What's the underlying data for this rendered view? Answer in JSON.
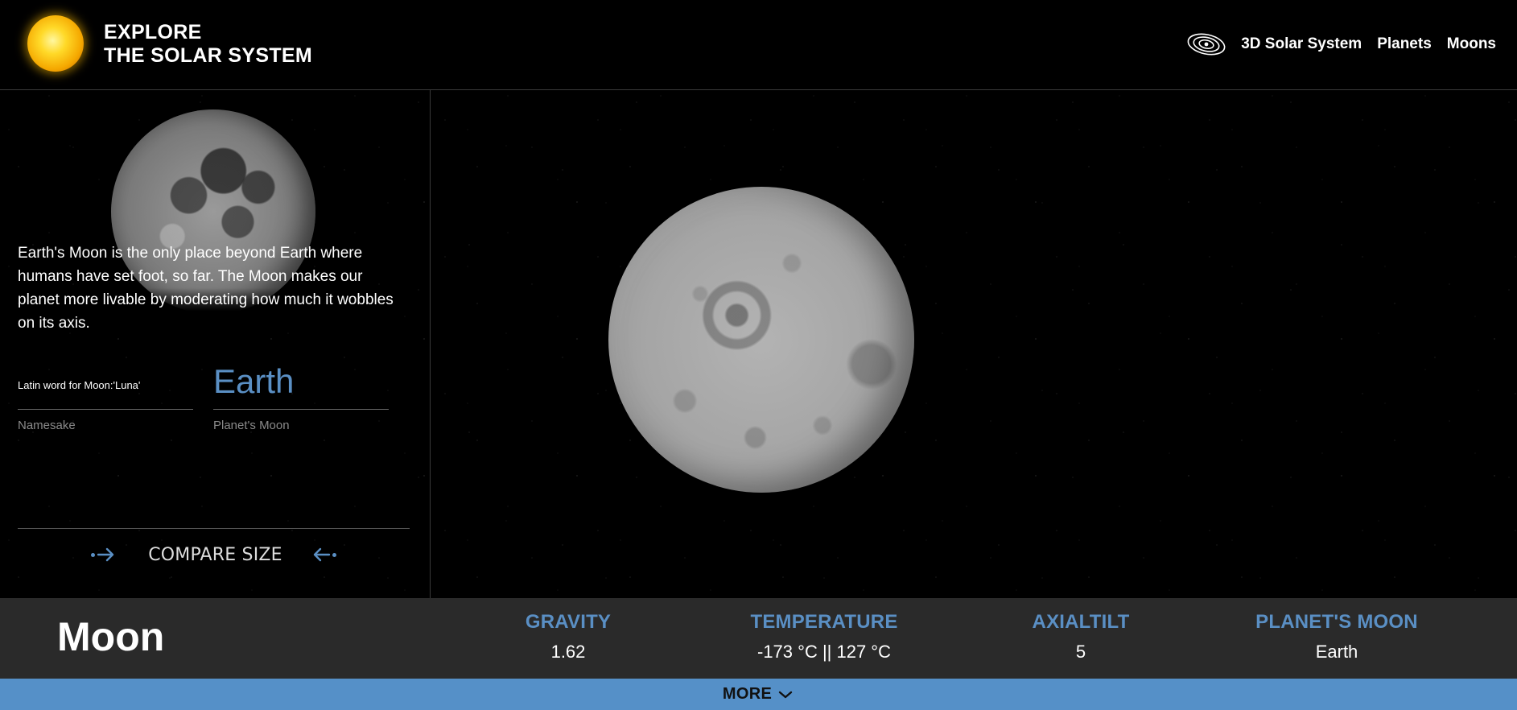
{
  "header": {
    "brand_line1": "EXPLORE",
    "brand_line2": "THE SOLAR SYSTEM",
    "logo_icon": "sun-icon",
    "nav_icon": "orbits-icon",
    "nav": [
      {
        "label": "3D Solar System"
      },
      {
        "label": "Planets"
      },
      {
        "label": "Moons"
      }
    ]
  },
  "sidebar": {
    "description": "Earth's Moon is the only place beyond Earth where humans have set foot, so far. The Moon makes our planet more livable by moderating how much it wobbles on its axis.",
    "facts": [
      {
        "value": "Latin word for Moon:'Luna'",
        "label": "Namesake"
      },
      {
        "value": "Earth",
        "label": "Planet's Moon"
      }
    ],
    "compare_label": "COMPARE SIZE"
  },
  "stats": {
    "name": "Moon",
    "items": [
      {
        "label": "GRAVITY",
        "value": "1.62"
      },
      {
        "label": "TEMPERATURE",
        "value": "-173 °C || 127 °C"
      },
      {
        "label": "AXIALTILT",
        "value": "5"
      },
      {
        "label": "PLANET'S MOON",
        "value": "Earth"
      }
    ]
  },
  "more_label": "MORE",
  "colors": {
    "accent": "#5590c8",
    "stats_bar": "#2a2a2a",
    "background": "#000000"
  }
}
